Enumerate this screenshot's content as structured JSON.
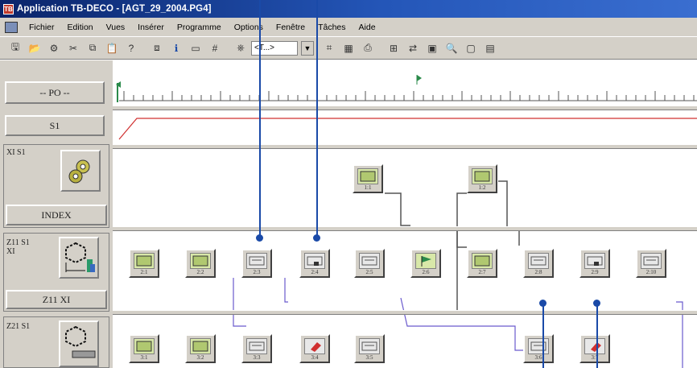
{
  "window": {
    "title": "Application TB-DECO - [AGT_29_2004.PG4]",
    "app_icon": "TB"
  },
  "menu": {
    "items": [
      "Fichier",
      "Edition",
      "Vues",
      "Insérer",
      "Programme",
      "Options",
      "Fenêtre",
      "Tâches",
      "Aide"
    ]
  },
  "toolbar": {
    "combo_value": "<T...>",
    "combo_arrow": "▼"
  },
  "left": {
    "po_label": "-- PO --",
    "s1_label": "S1",
    "row1_title": "XI S1",
    "row1_sub": "INDEX",
    "row2_title_a": "Z11 S1",
    "row2_title_b": "XI",
    "row2_sub": "Z11 XI",
    "row3_title": "Z21 S1"
  },
  "steps": {
    "s11": "1:1",
    "s12": "1:2",
    "s21": "2:1",
    "s22": "2:2",
    "s23": "2:3",
    "s24": "2:4",
    "s25": "2:5",
    "s26": "2:6",
    "s27": "2:7",
    "s28": "2:8",
    "s29": "2:9",
    "s210": "2:10",
    "s31": "3:1",
    "s32": "3:2",
    "s33": "3:3",
    "s34": "3:4",
    "s35": "3:5",
    "s36": "3:6",
    "s37": "3:7"
  },
  "colors": {
    "title_bar": "#0a246a",
    "chrome": "#d4d0c8",
    "callout": "#1a4aa8",
    "signal_line": "#d03030",
    "link_line": "#6a5acd"
  }
}
